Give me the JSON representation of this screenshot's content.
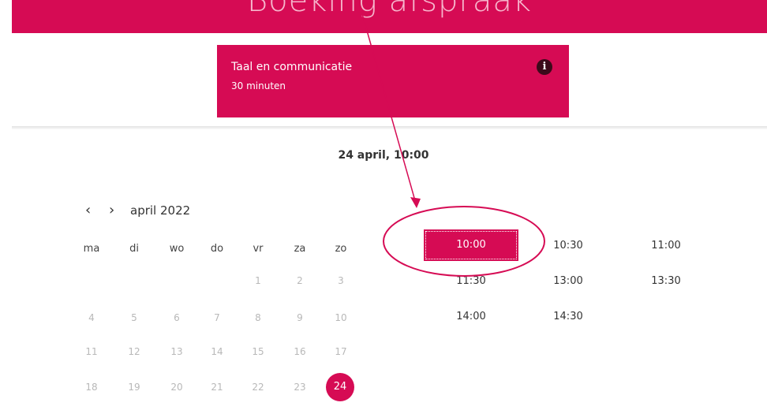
{
  "header": {
    "title": "Boeking afspraak",
    "color": "#d60b54"
  },
  "service": {
    "name": "Taal en communicatie",
    "duration": "30 minuten",
    "info_icon": "info-icon"
  },
  "summary": "24 april, 10:00",
  "calendar": {
    "prev_icon": "chevron-left-icon",
    "next_icon": "chevron-right-icon",
    "prev_label": "‹",
    "next_label": "›",
    "month": "april 2022",
    "weekdays": [
      "ma",
      "di",
      "wo",
      "do",
      "vr",
      "za",
      "zo"
    ],
    "weeks": [
      [
        "",
        "",
        "",
        "",
        "1",
        "2",
        "3"
      ],
      [
        "4",
        "5",
        "6",
        "7",
        "8",
        "9",
        "10"
      ],
      [
        "11",
        "12",
        "13",
        "14",
        "15",
        "16",
        "17"
      ],
      [
        "18",
        "19",
        "20",
        "21",
        "22",
        "23",
        "24"
      ]
    ],
    "selected_day": "24"
  },
  "time_slots": {
    "rows": [
      [
        "10:00",
        "10:30",
        "11:00"
      ],
      [
        "11:30",
        "13:00",
        "13:30"
      ],
      [
        "14:00",
        "14:30",
        ""
      ]
    ],
    "selected": "10:00"
  },
  "colors": {
    "accent": "#d60b54",
    "text": "#333333",
    "muted": "#b8b8b8"
  }
}
